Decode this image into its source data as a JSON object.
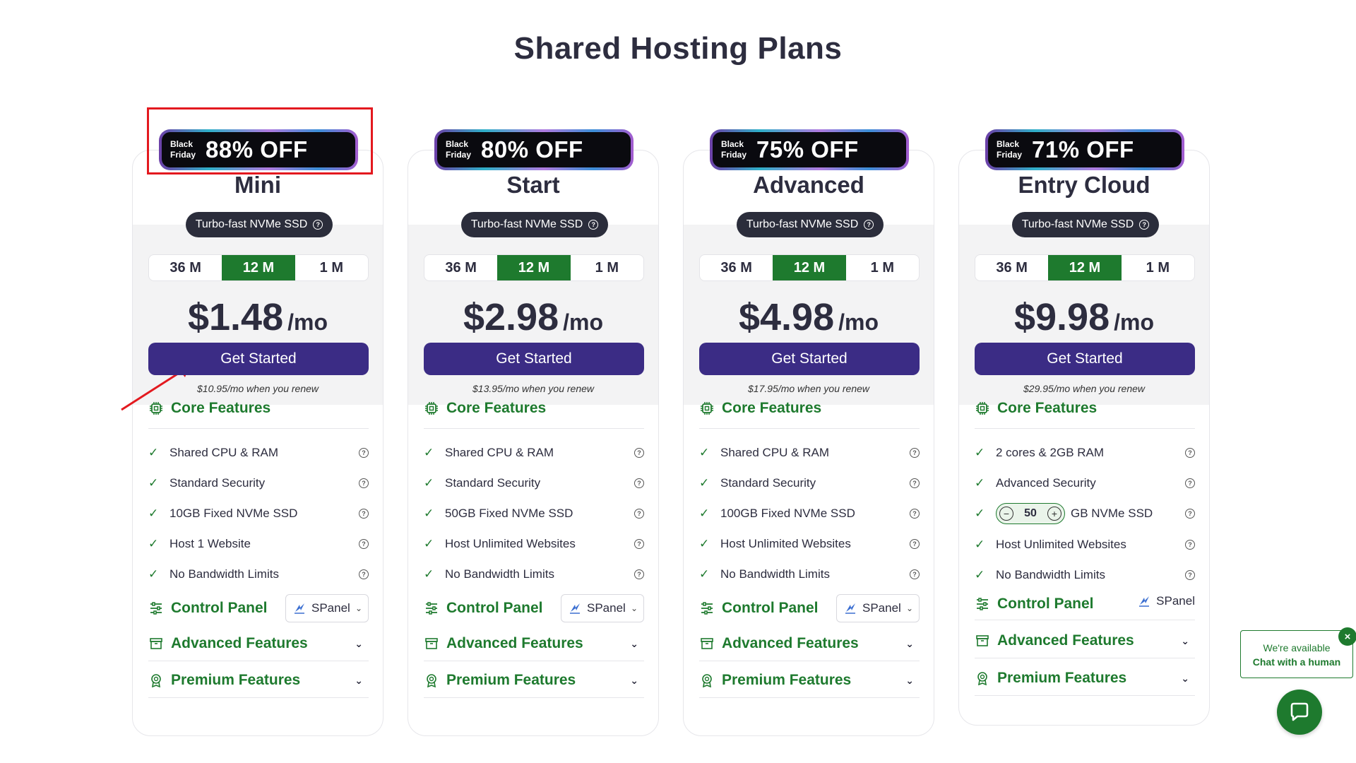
{
  "page": {
    "title": "Shared Hosting Plans"
  },
  "common": {
    "badge_small_1": "Black",
    "badge_small_2": "Friday",
    "nvme_label": "Turbo-fast NVMe SSD",
    "periods": [
      "36 M",
      "12 M",
      "1 M"
    ],
    "active_period": "12 M",
    "mo": "/mo",
    "cta": "Get Started",
    "core_features": "Core Features",
    "control_panel": "Control Panel",
    "spanel": "SPanel",
    "advanced_features": "Advanced Features",
    "premium_features": "Premium Features"
  },
  "plans": [
    {
      "badge": "88% OFF",
      "name": "Mini",
      "price": "$1.48",
      "renew": "$10.95/mo when you renew",
      "features": [
        "Shared CPU & RAM",
        "Standard Security",
        "10GB Fixed NVMe SSD",
        "Host 1 Website",
        "No Bandwidth Limits"
      ]
    },
    {
      "badge": "80% OFF",
      "name": "Start",
      "price": "$2.98",
      "renew": "$13.95/mo when you renew",
      "features": [
        "Shared CPU & RAM",
        "Standard Security",
        "50GB Fixed NVMe SSD",
        "Host Unlimited Websites",
        "No Bandwidth Limits"
      ]
    },
    {
      "badge": "75% OFF",
      "name": "Advanced",
      "price": "$4.98",
      "renew": "$17.95/mo when you renew",
      "features": [
        "Shared CPU & RAM",
        "Standard Security",
        "100GB Fixed NVMe SSD",
        "Host Unlimited Websites",
        "No Bandwidth Limits"
      ]
    },
    {
      "badge": "71% OFF",
      "name": "Entry Cloud",
      "price": "$9.98",
      "renew": "$29.95/mo when you renew",
      "features": [
        "2 cores & 2GB RAM",
        "Advanced Security",
        "GB NVMe SSD",
        "Host Unlimited Websites",
        "No Bandwidth Limits"
      ],
      "ssd_stepper_value": "50"
    }
  ],
  "chat": {
    "line1": "We're available",
    "line2": "Chat with a human"
  },
  "colors": {
    "green": "#1e7a2e",
    "purple": "#3b2c85",
    "dark": "#2b2d3b",
    "highlight": "#e3191f"
  }
}
